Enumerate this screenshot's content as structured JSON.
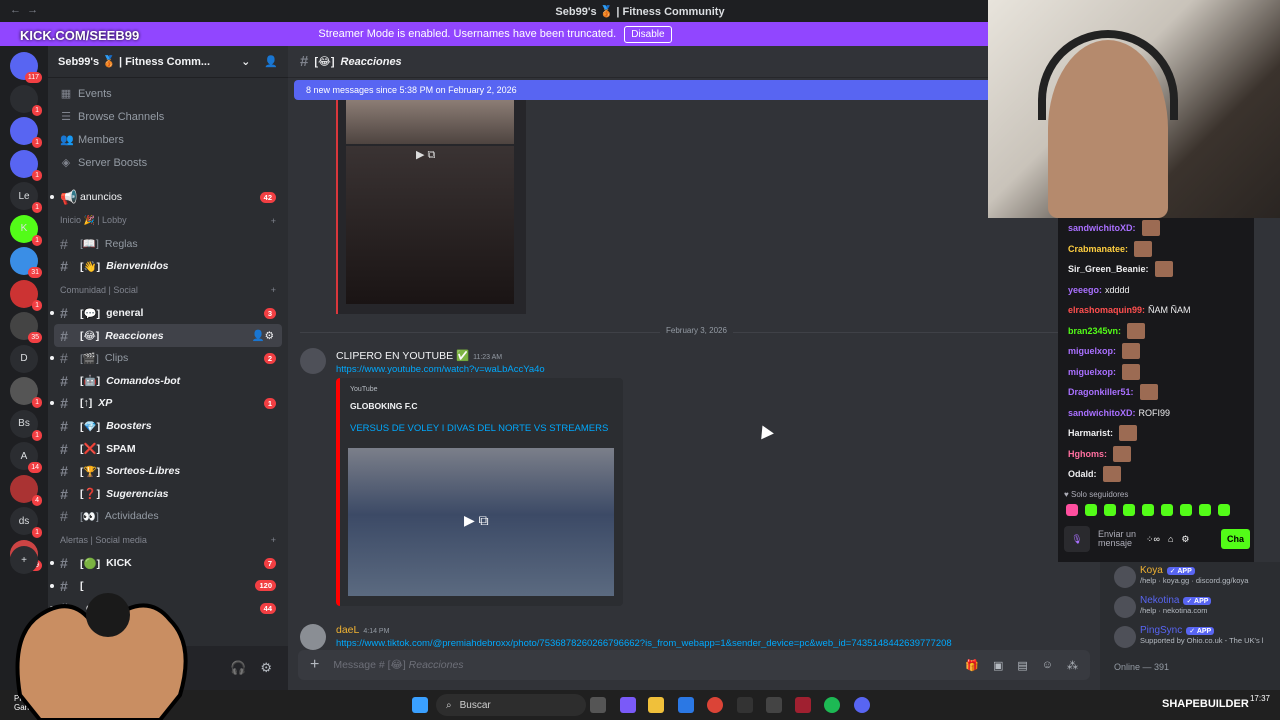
{
  "window": {
    "title": "Seb99's 🥉 | Fitness Community"
  },
  "streamer_banner": {
    "text": "Streamer Mode is enabled. Usernames have been truncated.",
    "button": "Disable"
  },
  "overlay_tag": "KICK.COM/SEEB99",
  "guilds": [
    {
      "label": "",
      "badge": "117"
    },
    {
      "label": "",
      "badge": "1"
    },
    {
      "label": "",
      "badge": "1"
    },
    {
      "label": "",
      "badge": "1"
    },
    {
      "label": "Le",
      "badge": "1"
    },
    {
      "label": "K",
      "badge": "1"
    },
    {
      "label": "",
      "badge": "31"
    },
    {
      "label": "",
      "badge": "1"
    },
    {
      "label": "",
      "badge": "35"
    },
    {
      "label": "D",
      "badge": ""
    },
    {
      "label": "",
      "badge": "1"
    },
    {
      "label": "Bs",
      "badge": "1"
    },
    {
      "label": "A",
      "badge": "14"
    },
    {
      "label": "",
      "badge": "4"
    },
    {
      "label": "ds",
      "badge": "1"
    },
    {
      "label": "",
      "badge": "219"
    }
  ],
  "sidebar": {
    "server_name": "Seb99's 🥉 | Fitness Comm...",
    "menu": [
      {
        "label": "Events",
        "icon": "calendar-icon"
      },
      {
        "label": "Browse Channels",
        "icon": "browse-icon"
      },
      {
        "label": "Members",
        "icon": "members-icon"
      },
      {
        "label": "Server Boosts",
        "icon": "boost-icon"
      }
    ],
    "announcements": {
      "label": "anuncios",
      "count": "42"
    },
    "categories": [
      {
        "name": "Inicio 🎉 | Lobby",
        "channels": [
          {
            "label": "Reglas",
            "prefix": "[📖]",
            "style": "muted",
            "count": ""
          },
          {
            "label": "Bienvenidos",
            "prefix": "[👋]",
            "style": "bright-italic",
            "count": ""
          }
        ]
      },
      {
        "name": "Comunidad | Social",
        "channels": [
          {
            "label": "general",
            "prefix": "[💬]",
            "style": "bright",
            "count": "3"
          },
          {
            "label": "Reacciones",
            "prefix": "[😂]",
            "style": "active",
            "count": ""
          },
          {
            "label": "Clips",
            "prefix": "[🎬]",
            "style": "muted",
            "count": "2"
          },
          {
            "label": "Comandos-bot",
            "prefix": "[🤖]",
            "style": "bright-italic",
            "count": ""
          },
          {
            "label": "XP",
            "prefix": "[↑]",
            "style": "bright-italic",
            "count": "1"
          },
          {
            "label": "Boosters",
            "prefix": "[💎]",
            "style": "bright-italic",
            "count": ""
          },
          {
            "label": "SPAM",
            "prefix": "[❌]",
            "style": "bright",
            "count": ""
          },
          {
            "label": "Sorteos-Libres",
            "prefix": "[🏆]",
            "style": "bright-italic",
            "count": ""
          },
          {
            "label": "Sugerencias",
            "prefix": "[❓]",
            "style": "bright-italic",
            "count": ""
          },
          {
            "label": "Actividades",
            "prefix": "[👀]",
            "style": "muted",
            "count": ""
          }
        ]
      },
      {
        "name": "Alertas | Social media",
        "channels": [
          {
            "label": "KICK",
            "prefix": "[🟢]",
            "style": "bright",
            "count": "7"
          },
          {
            "label": "",
            "prefix": "[",
            "style": "bright",
            "count": "120"
          },
          {
            "label": "gram",
            "prefix": "",
            "style": "bright",
            "count": "44"
          }
        ]
      }
    ]
  },
  "channel": {
    "name": "Reacciones",
    "prefix": "[😂]",
    "new_messages_bar": "8 new messages since 5:38 PM on February 2, 2026",
    "date_divider": "February 3, 2026",
    "message1": {
      "author": "CLIPERO EN YOUTUBE ✅",
      "time": "11:23 AM",
      "link": "https://www.youtube.com/watch?v=waLbAccYa4o",
      "embed_provider": "YouTube",
      "embed_author": "GLOBOKING F.C",
      "embed_title": "VERSUS DE VOLEY I DIVAS DEL NORTE VS STREAMERS"
    },
    "message2": {
      "author": "daeL",
      "time": "4:14 PM",
      "link": "https://www.tiktok.com/@premiahdebroxx/photo/7536878260266796662?is_from_webapp=1&sender_device=pc&web_id=7435148442639777208"
    },
    "composer_placeholder": "Message #",
    "composer_channel": "Reacciones"
  },
  "kick_chat": {
    "lines": [
      {
        "user": "sandwichitoXD:",
        "text": "",
        "color": "#a970ff",
        "emote": true
      },
      {
        "user": "Crabmanatee:",
        "text": "",
        "color": "#ffcf40",
        "emote": true
      },
      {
        "user": "Sir_Green_Beanie:",
        "text": "",
        "color": "#efeff1",
        "emote": true
      },
      {
        "user": "yeeego:",
        "text": "xdddd",
        "color": "#a970ff",
        "emote": false
      },
      {
        "user": "elrashomaquin99:",
        "text": "ÑAM ÑAM",
        "color": "#ff4f4f",
        "emote": false
      },
      {
        "user": "bran2345vn:",
        "text": "",
        "color": "#53fc18",
        "emote": true
      },
      {
        "user": "miguelxop:",
        "text": "",
        "color": "#a970ff",
        "emote": true
      },
      {
        "user": "miguelxop:",
        "text": "",
        "color": "#a970ff",
        "emote": true
      },
      {
        "user": "Dragonkiller51:",
        "text": "",
        "color": "#a970ff",
        "emote": true
      },
      {
        "user": "sandwichitoXD:",
        "text": "ROFI99",
        "color": "#a970ff",
        "emote": false
      },
      {
        "user": "Harmarist:",
        "text": "",
        "color": "#efeff1",
        "emote": true
      },
      {
        "user": "Hghoms:",
        "text": "",
        "color": "#ff6f9f",
        "emote": true
      },
      {
        "user": "Odald:",
        "text": "",
        "color": "#efeff1",
        "emote": true
      }
    ],
    "followers_only": "Solo seguidores",
    "send_placeholder": "Enviar un mensaje",
    "chat_button": "Cha"
  },
  "members": [
    {
      "name": "Koya",
      "tag": "APP",
      "status": "/help · koya.gg · discord.gg/koya",
      "color": "#f0b232"
    },
    {
      "name": "Nekotina",
      "tag": "APP",
      "status": "/help · nekotina.com",
      "color": "#5865f2"
    },
    {
      "name": "PingSync",
      "tag": "APP",
      "status": "Supported by Ohio.co.uk - The UK's l",
      "color": "#5865f2"
    }
  ],
  "online_label": "Online — 391",
  "taskbar": {
    "search": "Buscar",
    "left_text_1": "Próx",
    "left_text_2": "Gana",
    "clock": "17:37",
    "overlay_brand": "SHAPEBUILDER"
  }
}
